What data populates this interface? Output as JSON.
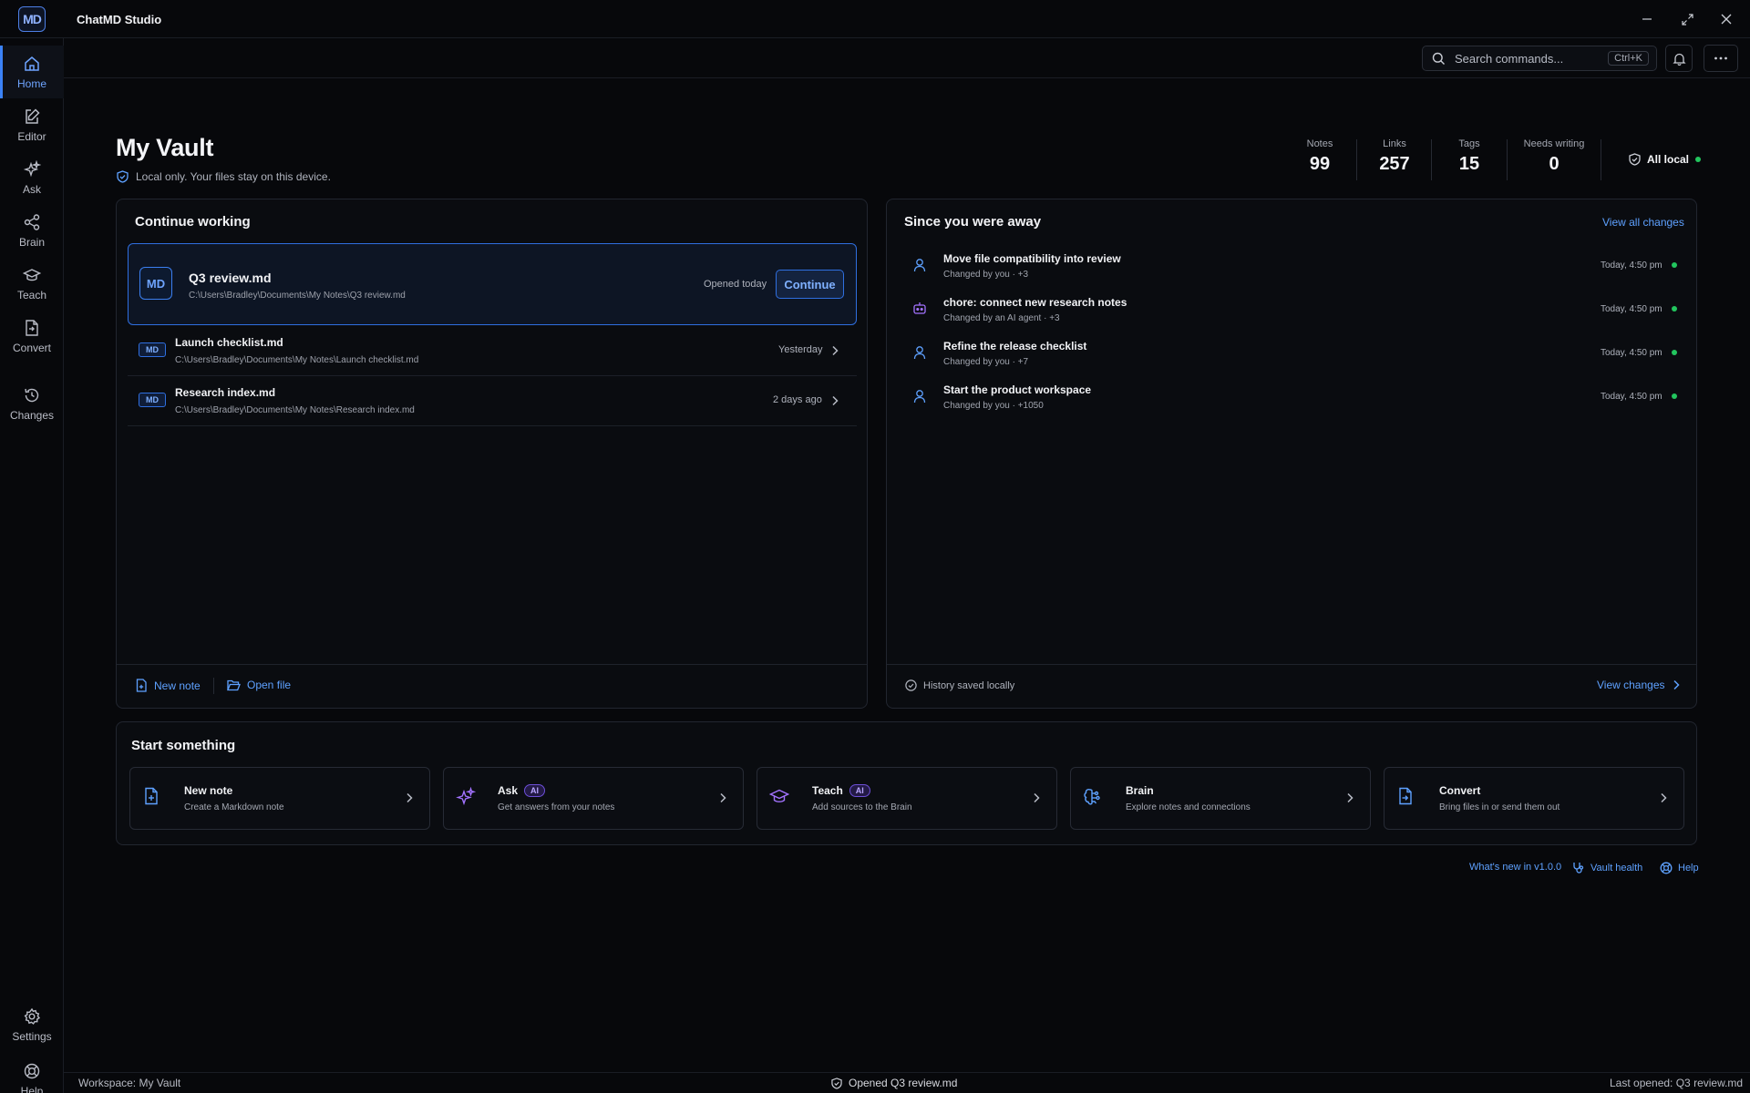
{
  "app": {
    "logo": "MD",
    "title": "ChatMD Studio"
  },
  "window_controls": {
    "minimize_icon": "minimize-icon",
    "maximize_icon": "maximize-icon",
    "close_icon": "close-icon"
  },
  "sidebar": {
    "items": [
      {
        "label": "Home",
        "icon": "home-icon",
        "active": true
      },
      {
        "label": "Editor",
        "icon": "edit-icon"
      },
      {
        "label": "Ask",
        "icon": "sparkles-icon"
      },
      {
        "label": "Brain",
        "icon": "share-nodes-icon"
      },
      {
        "label": "Teach",
        "icon": "graduation-cap-icon"
      },
      {
        "label": "Convert",
        "icon": "file-convert-icon"
      },
      {
        "label": "Changes",
        "icon": "history-icon"
      }
    ],
    "bottom": [
      {
        "label": "Settings",
        "icon": "gear-icon"
      },
      {
        "label": "Help",
        "icon": "lifebuoy-icon"
      }
    ]
  },
  "topbar": {
    "search_placeholder": "Search commands...",
    "shortcut": "Ctrl+K"
  },
  "header": {
    "title": "My Vault",
    "subtitle": "Local only. Your files stay on this device.",
    "stats": [
      {
        "label": "Notes",
        "value": "99"
      },
      {
        "label": "Links",
        "value": "257"
      },
      {
        "label": "Tags",
        "value": "15"
      },
      {
        "label": "Needs writing",
        "value": "0"
      }
    ],
    "local_status": "All local"
  },
  "continue_working": {
    "title": "Continue working",
    "featured": {
      "badge": "MD",
      "name": "Q3 review.md",
      "path": "C:\\Users\\Bradley\\Documents\\My Notes\\Q3 review.md",
      "time": "Opened today",
      "action": "Continue"
    },
    "files": [
      {
        "badge": "MD",
        "name": "Launch checklist.md",
        "path": "C:\\Users\\Bradley\\Documents\\My Notes\\Launch checklist.md",
        "time": "Yesterday"
      },
      {
        "badge": "MD",
        "name": "Research index.md",
        "path": "C:\\Users\\Bradley\\Documents\\My Notes\\Research index.md",
        "time": "2 days ago"
      }
    ],
    "new_note": "New note",
    "open_file": "Open file"
  },
  "away": {
    "title": "Since you were away",
    "view_all": "View all changes",
    "items": [
      {
        "title": "Move file compatibility into review",
        "sub": "Changed by you · +3",
        "time": "Today, 4:50 pm",
        "icon": "user-icon"
      },
      {
        "title": "chore: connect new research notes",
        "sub": "Changed by an AI agent · +3",
        "time": "Today, 4:50 pm",
        "icon": "bot-icon"
      },
      {
        "title": "Refine the release checklist",
        "sub": "Changed by you · +7",
        "time": "Today, 4:50 pm",
        "icon": "user-icon"
      },
      {
        "title": "Start the product workspace",
        "sub": "Changed by you · +1050",
        "time": "Today, 4:50 pm",
        "icon": "user-icon"
      }
    ],
    "history_note": "History saved locally",
    "view_changes": "View changes"
  },
  "start": {
    "title": "Start something",
    "cards": [
      {
        "title": "New note",
        "sub": "Create a Markdown note",
        "badge": "",
        "icon": "new-file-icon"
      },
      {
        "title": "Ask",
        "sub": "Get answers from your notes",
        "badge": "AI",
        "icon": "sparkles-icon"
      },
      {
        "title": "Teach",
        "sub": "Add sources to the Brain",
        "badge": "AI",
        "icon": "graduation-cap-icon"
      },
      {
        "title": "Brain",
        "sub": "Explore notes and connections",
        "badge": "",
        "icon": "brain-icon"
      },
      {
        "title": "Convert",
        "sub": "Bring files in or send them out",
        "badge": "",
        "icon": "file-convert-icon"
      }
    ]
  },
  "footer_links": {
    "whats_new": "What's new in v1.0.0",
    "vault_health": "Vault health",
    "help": "Help"
  },
  "status": {
    "workspace": "Workspace: My Vault",
    "center": "Opened Q3 review.md",
    "last_opened": "Last opened: Q3 review.md"
  },
  "colors": {
    "accent": "#3b82f6",
    "link": "#5ea1ff",
    "ai": "#8b5cf6",
    "ok": "#22c55e",
    "background": "#07080b"
  }
}
